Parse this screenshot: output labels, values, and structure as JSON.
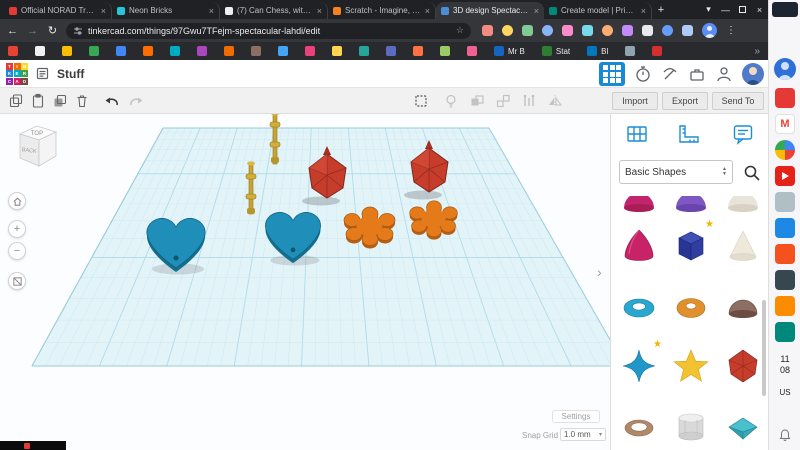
{
  "browser": {
    "tabs": [
      {
        "title": "Official NORAD Track..."
      },
      {
        "title": "Neon Bricks"
      },
      {
        "title": "(7) Can Chess, with H..."
      },
      {
        "title": "Scratch - Imagine, Pro..."
      },
      {
        "title": "3D design Spectacular..."
      },
      {
        "title": "Create model | Printab..."
      }
    ],
    "url": "tinkercad.com/things/97Gwu7TFejm-spectacular-lahdi/edit",
    "bookmark_labels": [
      "Mr B",
      "Stat",
      "Bl"
    ]
  },
  "glyphs": {
    "close": "×",
    "plus": "+",
    "back": "←",
    "forward": "→",
    "reload": "↻",
    "menu": "⋮",
    "minimize": "—",
    "tab_search": "▾",
    "overflow": "»",
    "chevron_right": "›",
    "caret_down": "▾",
    "star_badge": "★",
    "spin_up": "▲",
    "spin_down": "▼",
    "zoom_in": "+",
    "zoom_out": "−",
    "bookmark_star": "☆",
    "gmail_m": "M"
  },
  "app": {
    "design_name": "Stuff",
    "logo": [
      "T",
      "I",
      "N",
      "K",
      "E",
      "R",
      "C",
      "A",
      "D"
    ],
    "actions": {
      "import": "Import",
      "export": "Export",
      "send_to": "Send To"
    },
    "panel": {
      "category": "Basic Shapes"
    },
    "viewport": {
      "cube_top": "TOP",
      "cube_back": "BACK",
      "settings": "Settings",
      "snap_label": "Snap Grid",
      "snap_value": "1.0 mm"
    },
    "colors": {
      "accent_blue": "#1b8ed1",
      "workplane": "#e3f4f9",
      "gem_red": "#c63d2c",
      "heart_blue": "#1f8fba",
      "splat_orange": "#e57a1a",
      "axle_gold": "#c9a431"
    },
    "shape_names": [
      "paraboloid",
      "hex-prism",
      "cone",
      "torus",
      "tube",
      "half-sphere",
      "shooting-star",
      "star",
      "icosahedron",
      "ring",
      "cylinder",
      "diamond"
    ]
  },
  "taskbar": {
    "clock_h": "11",
    "clock_m": "08",
    "lang": "US"
  }
}
